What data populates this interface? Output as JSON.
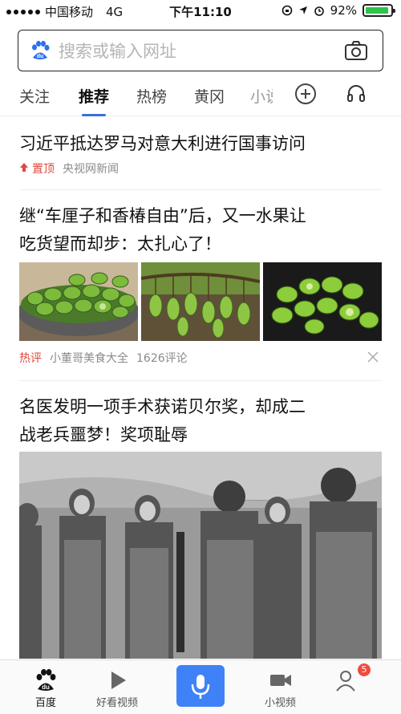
{
  "status_bar": {
    "carrier": "中国移动",
    "network": "4G",
    "time": "下午11:10",
    "battery": "92%",
    "battery_level": 0.92
  },
  "search": {
    "placeholder": "搜索或输入网址"
  },
  "tabs": [
    {
      "label": "关注"
    },
    {
      "label": "推荐",
      "active": true
    },
    {
      "label": "热榜"
    },
    {
      "label": "黄冈"
    },
    {
      "label": "小说"
    }
  ],
  "feed": [
    {
      "title": "习近平抵达罗马对意大利进行国事访问",
      "tag": "置顶",
      "source": "央视网新闻"
    },
    {
      "title_line1": "继“车厘子和香椿自由”后，又一水果让",
      "title_line2": "吃货望而却步：太扎心了！",
      "tag": "热评",
      "source": "小董哥美食大全",
      "comments": "1626评论"
    },
    {
      "title_line1": "名医发明一项手术获诺贝尔奖，却成二",
      "title_line2": "战老兵噩梦！奖项耻辱"
    }
  ],
  "bottom_nav": {
    "home": "百度",
    "video": "好看视频",
    "short_video": "小视频",
    "badge": "5"
  },
  "colors": {
    "accent": "#3b6fe0",
    "hot": "#e0473e",
    "mic": "#3f82f7",
    "battery": "#2ec44a"
  }
}
